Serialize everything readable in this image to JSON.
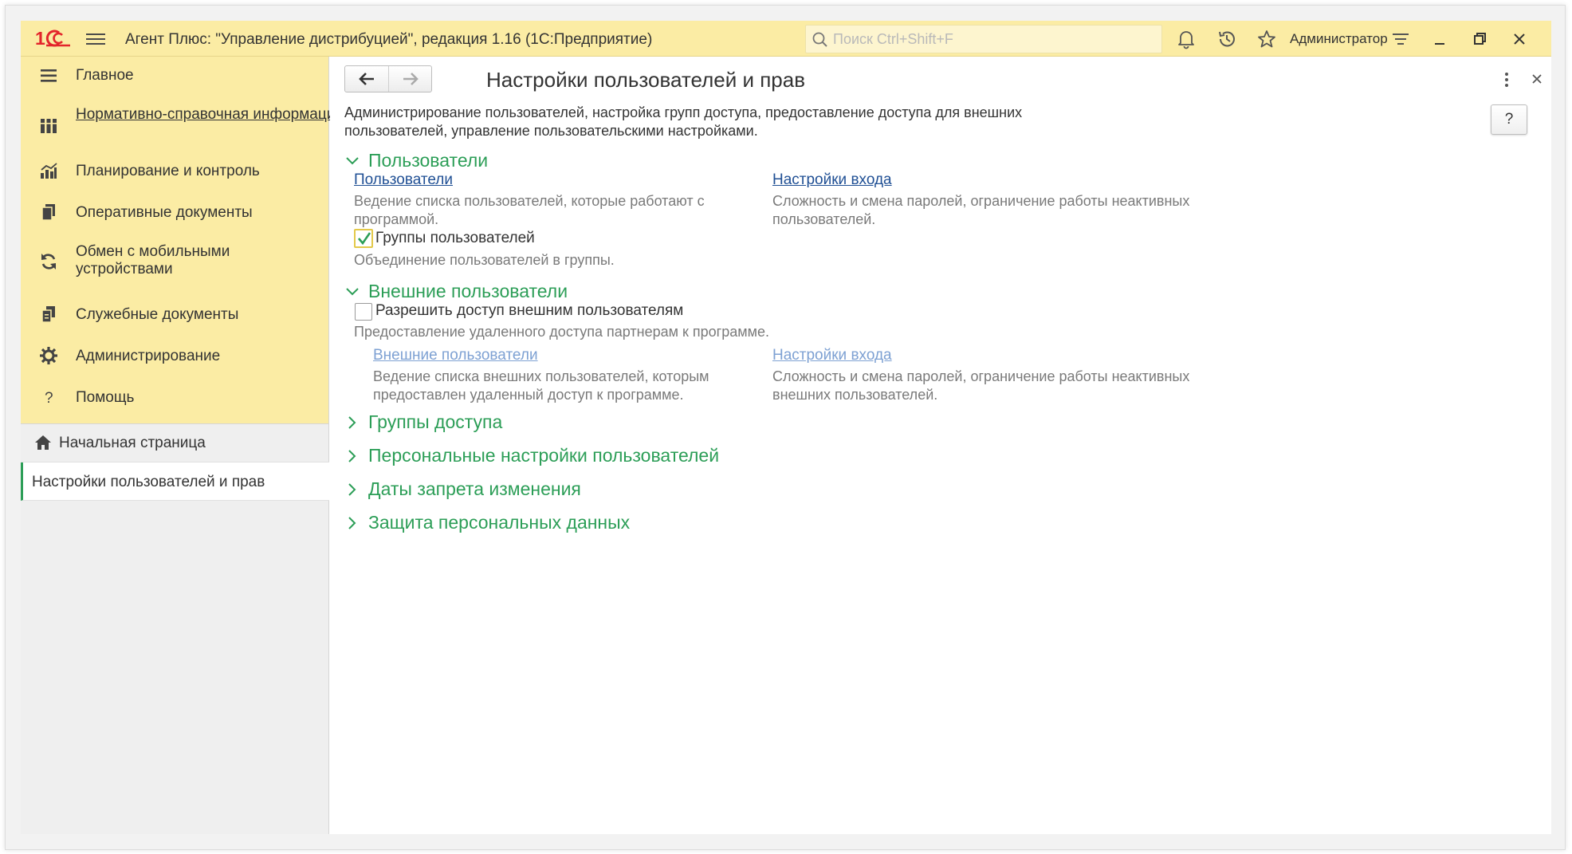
{
  "titlebar": {
    "app_title": "Агент Плюс: \"Управление дистрибуцией\", редакция 1.16  (1С:Предприятие)",
    "search_placeholder": "Поиск Ctrl+Shift+F",
    "user_name": "Администратор"
  },
  "sidebar": {
    "sections": [
      {
        "label": "Главное",
        "icon": "menu-list-icon"
      },
      {
        "label": "Нормативно-справочная информация",
        "icon": "catalog-icon"
      },
      {
        "label": "Планирование и контроль",
        "icon": "chart-icon"
      },
      {
        "label": "Оперативные документы",
        "icon": "documents-icon"
      },
      {
        "label": "Обмен с мобильными устройствами",
        "icon": "sync-icon"
      },
      {
        "label": "Служебные документы",
        "icon": "service-docs-icon"
      },
      {
        "label": "Администрирование",
        "icon": "gear-icon"
      },
      {
        "label": "Помощь",
        "icon": "question-icon"
      }
    ],
    "home_label": "Начальная страница",
    "active_tab_label": "Настройки пользователей и прав"
  },
  "form": {
    "title": "Настройки пользователей и прав",
    "help_label": "?",
    "description": "Администрирование пользователей, настройка групп доступа, предоставление доступа для внешних пользователей, управление пользовательскими настройками.",
    "users_group": {
      "title": "Пользователи",
      "users_link": "Пользователи",
      "users_hint": "Ведение списка пользователей, которые работают с программой.",
      "login_link": "Настройки входа",
      "login_hint": "Сложность и смена паролей, ограничение работы неактивных пользователей.",
      "groups_checkbox_label": "Группы пользователей",
      "groups_checked": true,
      "groups_hint": "Объединение пользователей в группы."
    },
    "external_group": {
      "title": "Внешние пользователи",
      "allow_checkbox_label": "Разрешить доступ внешним пользователям",
      "allow_checked": false,
      "allow_hint": "Предоставление удаленного доступа партнерам к программе.",
      "external_link": "Внешние пользователи",
      "external_hint": "Ведение списка внешних пользователей, которым предоставлен удаленный доступ к программе.",
      "login_link": "Настройки входа",
      "login_hint": "Сложность и смена паролей, ограничение работы неактивных внешних пользователей."
    },
    "collapsed_groups": [
      "Группы доступа",
      "Персональные настройки пользователей",
      "Даты запрета изменения",
      "Защита персональных данных"
    ]
  },
  "colors": {
    "titlebar_bg": "#fbeca4",
    "accent_green": "#2c9e57",
    "link_blue": "#1f4f94",
    "logo_red": "#e3252b"
  }
}
